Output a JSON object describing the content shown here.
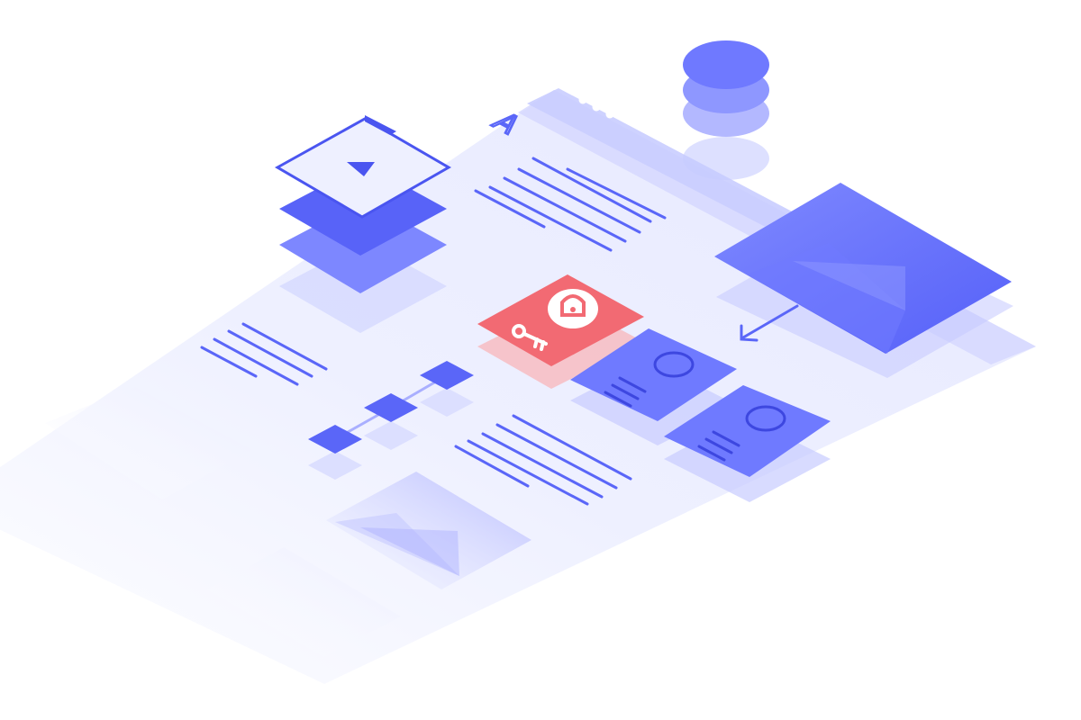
{
  "illustration": {
    "heading_glyph": "A",
    "icons": [
      "database-icon",
      "window-dots-icon",
      "video-play-icon",
      "image-icon",
      "key-icon",
      "lock-icon",
      "card-icon",
      "workflow-nodes-icon"
    ]
  },
  "colors": {
    "background": "#ffffff",
    "panel": "#eef0ff",
    "accent": "#5a66f8",
    "accent_light": "#a9afff",
    "accent_pale": "#dcdfff",
    "danger": "#f26a73",
    "danger_light": "#f7b9be"
  }
}
